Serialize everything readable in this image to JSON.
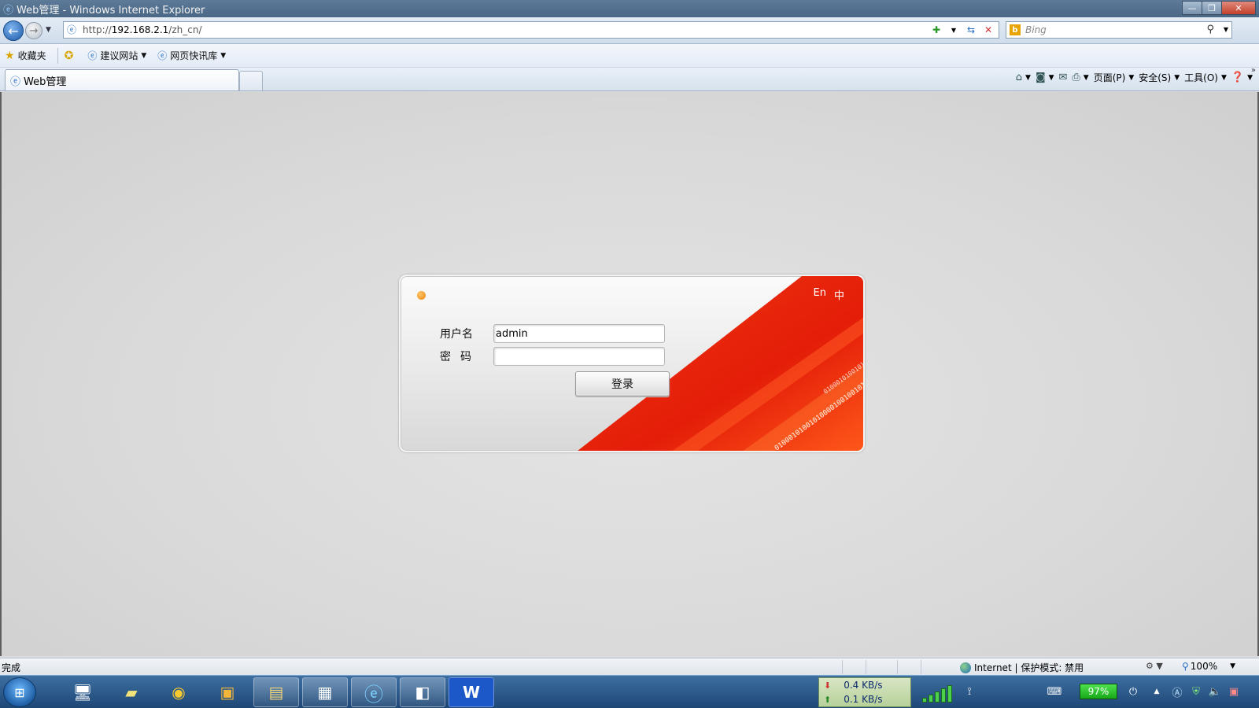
{
  "window": {
    "title": "Web管理 - Windows Internet Explorer",
    "minimize": "—",
    "maximize": "❐",
    "close": "✕"
  },
  "address_bar": {
    "url_prefix": "http://",
    "url_host": "192.168.2.1",
    "url_path": "/zh_cn/",
    "search_placeholder": "Bing"
  },
  "favorites_bar": {
    "favorites_label": "收藏夹",
    "suggested_sites": "建议网站",
    "web_slice_gallery": "网页快讯库"
  },
  "tabs": [
    {
      "label": "Web管理"
    }
  ],
  "command_bar": {
    "page_menu": "页面(P)",
    "safety_menu": "安全(S)",
    "tools_menu": "工具(O)"
  },
  "login": {
    "lang_en": "En",
    "lang_zh": "中",
    "username_label": "用户名",
    "password_label": "密码",
    "username_value": "admin",
    "password_value": "",
    "login_button": "登录",
    "binary_text": "01000101001010000100100101010111"
  },
  "status_bar": {
    "status_text": "完成",
    "zone_text": "Internet | 保护模式: 禁用",
    "zoom_text": "100%"
  },
  "taskbar": {
    "download_speed": "0.4 KB/s",
    "upload_speed": "0.1 KB/s",
    "battery_percent": "97%"
  },
  "colors": {
    "accent_red": "#e8200a",
    "orange_dot": "#e88a10",
    "taskbar_blue": "#1e4775"
  }
}
